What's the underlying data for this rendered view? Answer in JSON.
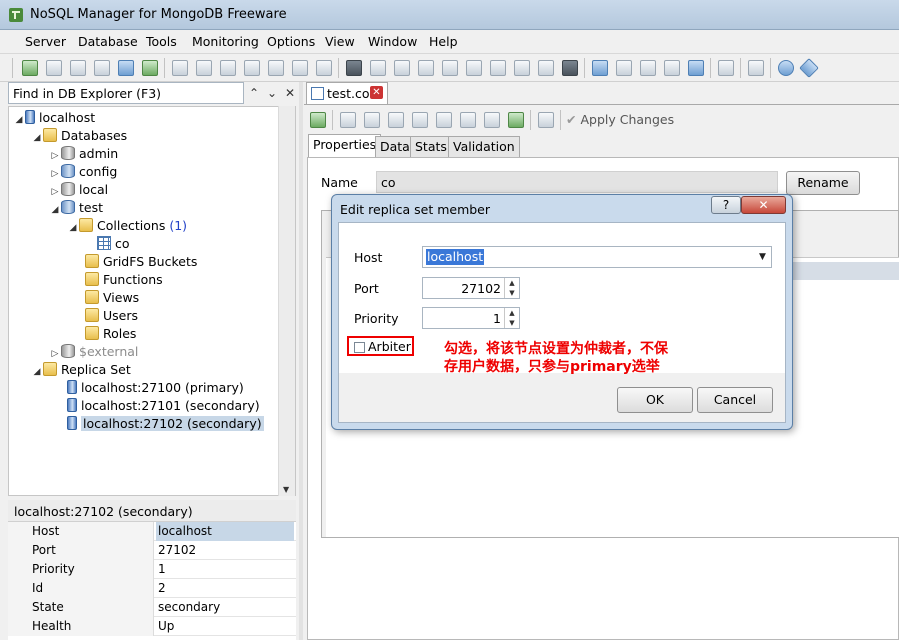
{
  "window": {
    "title": "NoSQL Manager for MongoDB Freeware"
  },
  "menu": [
    "Server",
    "Database",
    "Tools",
    "Monitoring",
    "Options",
    "View",
    "Window",
    "Help"
  ],
  "explorer": {
    "find_placeholder": "Find in DB Explorer (F3)",
    "tree": {
      "server": "localhost",
      "databases": "Databases",
      "admin": "admin",
      "config": "config",
      "local": "local",
      "test": "test",
      "collections": "Collections",
      "collections_count": "(1)",
      "co": "co",
      "gridfs": "GridFS Buckets",
      "functions": "Functions",
      "views": "Views",
      "users": "Users",
      "roles": "Roles",
      "external": "$external",
      "replica_set": "Replica Set",
      "member1": "localhost:27100 (primary)",
      "member2": "localhost:27101 (secondary)",
      "member3": "localhost:27102 (secondary)"
    }
  },
  "properties": {
    "header": "localhost:27102 (secondary)",
    "rows": [
      {
        "key": "Host",
        "value": "localhost"
      },
      {
        "key": "Port",
        "value": "27102"
      },
      {
        "key": "Priority",
        "value": "1"
      },
      {
        "key": "Id",
        "value": "2"
      },
      {
        "key": "State",
        "value": "secondary"
      },
      {
        "key": "Health",
        "value": "Up"
      }
    ]
  },
  "document": {
    "tab": "test.co",
    "apply_changes": "Apply Changes",
    "subtabs": [
      "Properties",
      "Data",
      "Stats",
      "Validation"
    ],
    "name_label": "Name",
    "name_value": "co",
    "rename": "Rename"
  },
  "dialog": {
    "title": "Edit replica set member",
    "help": "?",
    "close": "✕",
    "host_label": "Host",
    "host_value": "localhost",
    "port_label": "Port",
    "port_value": "27102",
    "priority_label": "Priority",
    "priority_value": "1",
    "arbiter_label": "Arbiter",
    "arbiter_checked": false,
    "annotation_line1": "勾选，将该节点设置为仲裁者，不保",
    "annotation_line2": "存用户数据，只参与primary选举",
    "ok": "OK",
    "cancel": "Cancel"
  },
  "colors": {
    "selection": "#c7d7e7",
    "annotation": "#ee0000",
    "host_highlight": "#3a78d8"
  }
}
